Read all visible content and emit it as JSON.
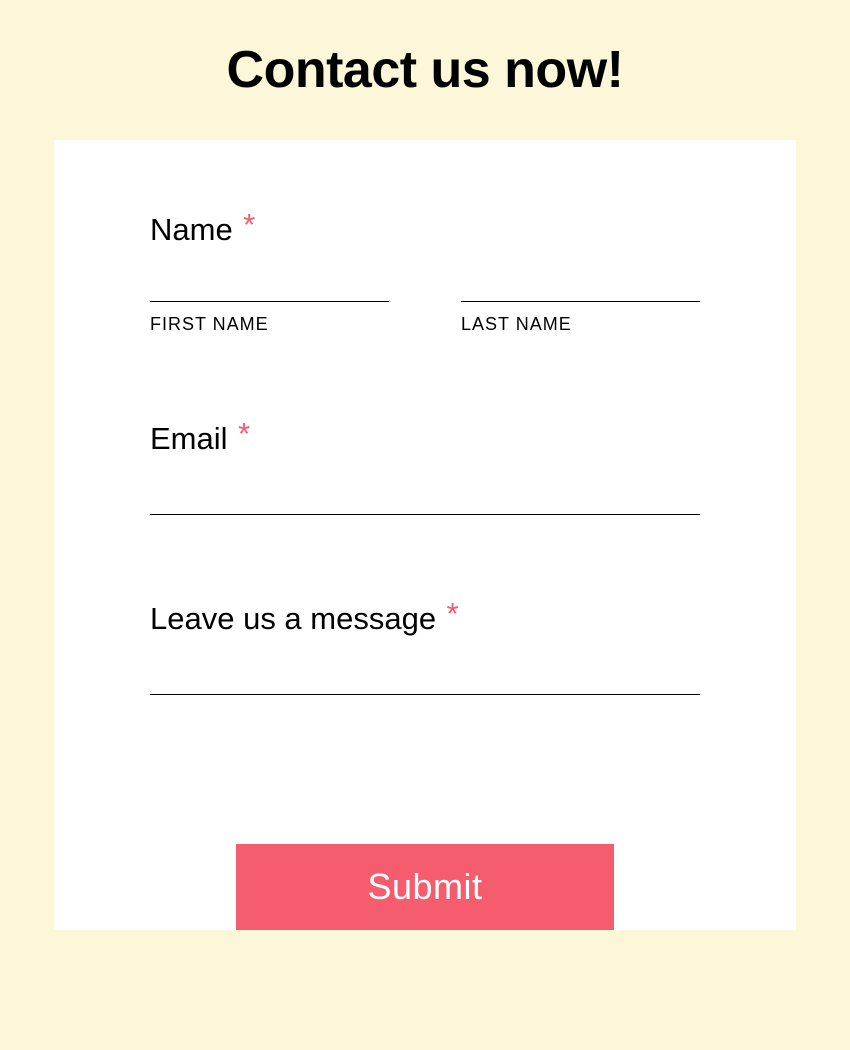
{
  "title": "Contact us now!",
  "required_mark": "*",
  "fields": {
    "name": {
      "label": "Name",
      "first_sub": "FIRST NAME",
      "last_sub": "LAST NAME",
      "first_value": "",
      "last_value": ""
    },
    "email": {
      "label": "Email",
      "value": ""
    },
    "message": {
      "label": "Leave us a message",
      "value": ""
    }
  },
  "submit_label": "Submit",
  "colors": {
    "background": "#FDF7D9",
    "card": "#FFFFFF",
    "accent": "#F55C6D",
    "text": "#000000"
  }
}
